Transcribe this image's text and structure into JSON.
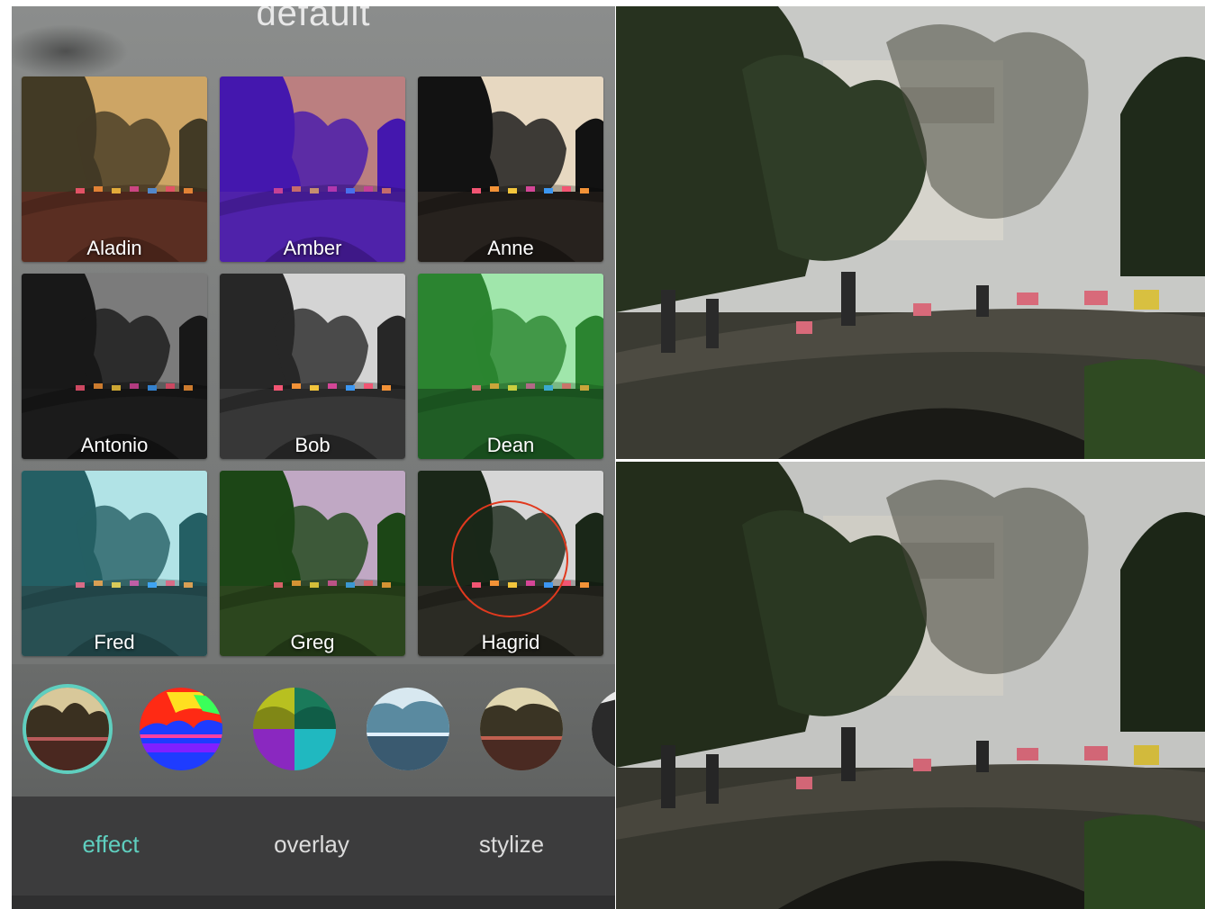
{
  "app": {
    "title": "default",
    "filters": [
      {
        "name": "Aladin",
        "sky": "#e3c87a",
        "trees": "#2a3a24",
        "bridge": "#4a2a20",
        "tint": "rgba(140,60,40,0.25)"
      },
      {
        "name": "Amber",
        "sky": "#f0b85a",
        "trees": "#3a1aa0",
        "bridge": "#4a2a9a",
        "tint": "rgba(90,20,200,0.35)"
      },
      {
        "name": "Anne",
        "sky": "#f4e4cc",
        "trees": "#141414",
        "bridge": "#2a2420",
        "tint": "rgba(0,0,0,0.05)"
      },
      {
        "name": "Antonio",
        "sky": "#9a9a9a",
        "trees": "#1e1e1e",
        "bridge": "#222222",
        "tint": "rgba(0,0,0,0.2)"
      },
      {
        "name": "Bob",
        "sky": "#e0e0e0",
        "trees": "#2a2a2a",
        "bridge": "#3a3a3a",
        "tint": "rgba(0,0,0,0.05)"
      },
      {
        "name": "Dean",
        "sky": "#c8f0d0",
        "trees": "#2c6e2c",
        "bridge": "#1e3a1e",
        "tint": "rgba(40,200,60,0.25)"
      },
      {
        "name": "Fred",
        "sky": "#cfeff0",
        "trees": "#1f4a4e",
        "bridge": "#243638",
        "tint": "rgba(60,180,190,0.2)"
      },
      {
        "name": "Greg",
        "sky": "#e6b4ee",
        "trees": "#1a3a14",
        "bridge": "#2e3a1e",
        "tint": "rgba(40,120,30,0.2)"
      },
      {
        "name": "Hagrid",
        "sky": "#e2e2e2",
        "trees": "#1c2a1a",
        "bridge": "#2e2e26",
        "tint": "rgba(0,0,0,0.05)"
      }
    ],
    "thumbnails": [
      {
        "name": "sepia-thumbnail",
        "selected": true
      },
      {
        "name": "heatmap-thumbnail",
        "selected": false
      },
      {
        "name": "quad-thumbnail",
        "selected": false
      },
      {
        "name": "frost-thumbnail",
        "selected": false
      },
      {
        "name": "vintage-thumbnail",
        "selected": false
      },
      {
        "name": "partial-thumbnail",
        "selected": false
      }
    ],
    "tabs": [
      {
        "label": "effect",
        "active": true
      },
      {
        "label": "overlay",
        "active": false
      },
      {
        "label": "stylize",
        "active": false
      }
    ],
    "colors": {
      "accent": "#5fcfbf",
      "marker": "#e1391e"
    }
  }
}
